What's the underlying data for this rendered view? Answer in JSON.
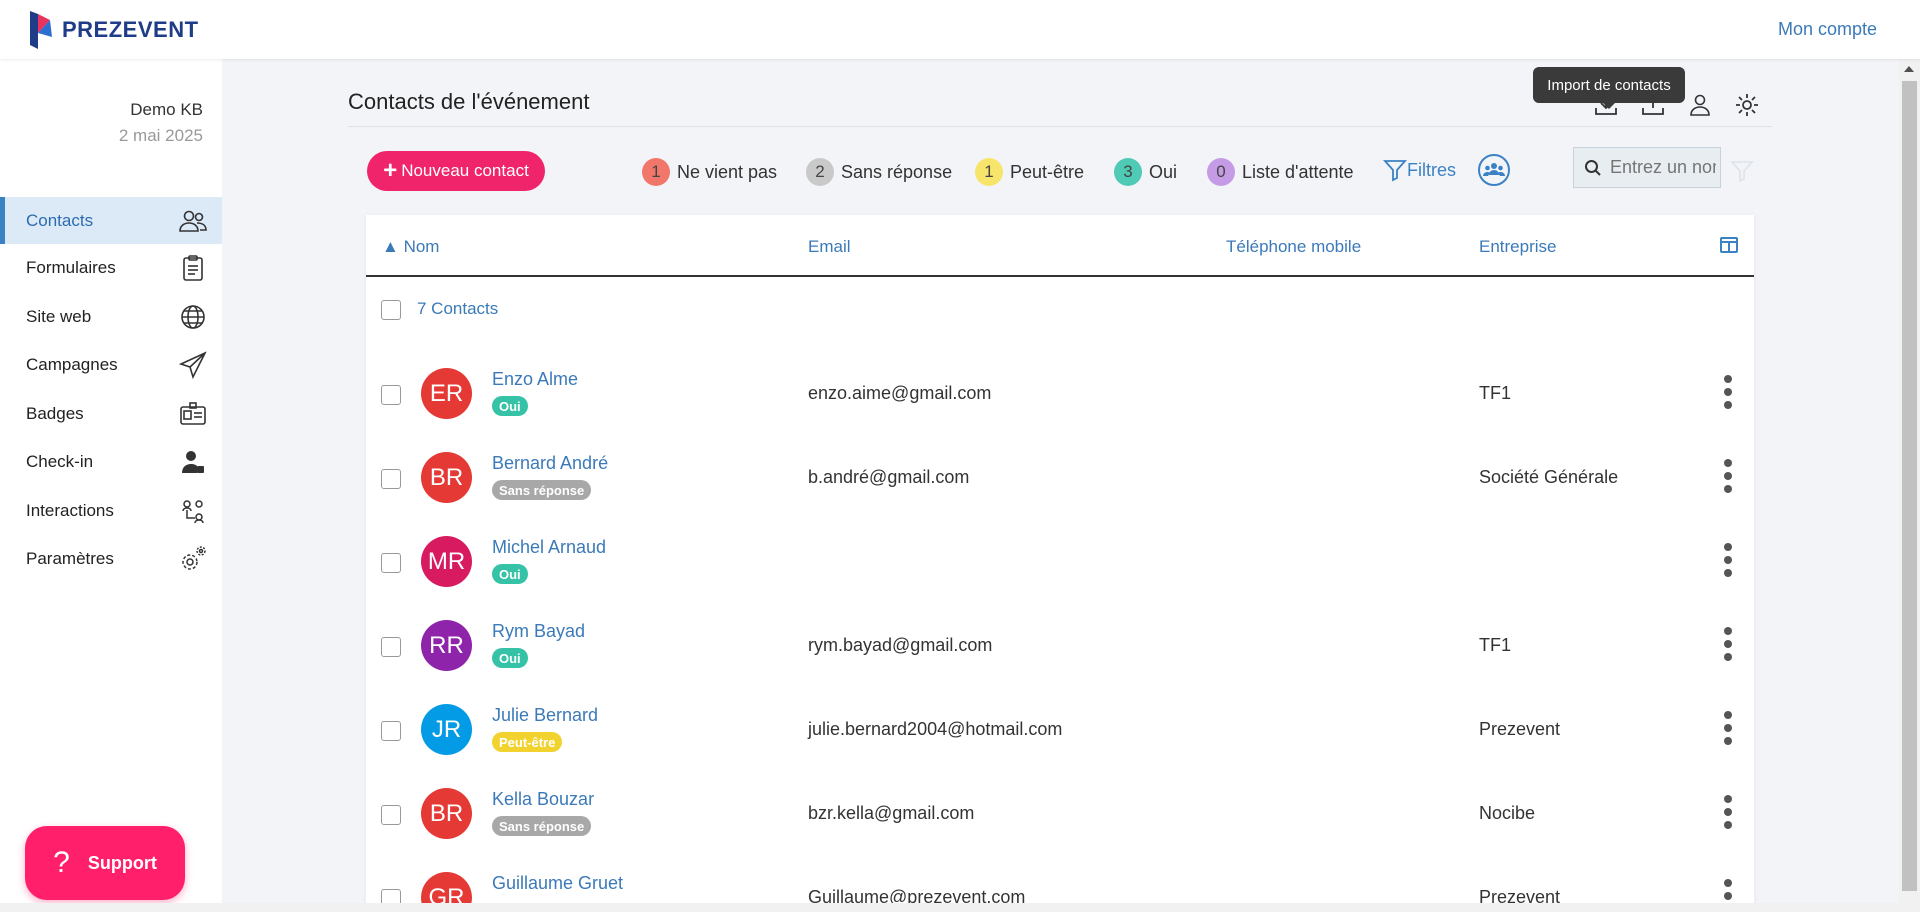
{
  "brand": {
    "name": "PREZEVENT"
  },
  "topbar": {
    "account_link": "Mon compte"
  },
  "sidebar": {
    "event_name": "Demo KB",
    "event_date": "2 mai 2025",
    "items": [
      {
        "label": "Contacts",
        "icon": "contacts-icon",
        "active": true
      },
      {
        "label": "Formulaires",
        "icon": "clipboard-icon"
      },
      {
        "label": "Site web",
        "icon": "globe-icon"
      },
      {
        "label": "Campagnes",
        "icon": "paper-plane-icon"
      },
      {
        "label": "Badges",
        "icon": "badge-card-icon"
      },
      {
        "label": "Check-in",
        "icon": "user-check-icon"
      },
      {
        "label": "Interactions",
        "icon": "interactions-icon"
      },
      {
        "label": "Paramètres",
        "icon": "gears-icon"
      }
    ],
    "support_label": "Support"
  },
  "header": {
    "title": "Contacts de l'événement",
    "tooltip": "Import de contacts"
  },
  "toolbar": {
    "new_contact_label": "Nouveau contact",
    "status_filters": [
      {
        "count": "1",
        "label": "Ne vient pas",
        "color": "#f2776b"
      },
      {
        "count": "2",
        "label": "Sans réponse",
        "color": "#c9c9c9"
      },
      {
        "count": "1",
        "label": "Peut-être",
        "color": "#f7e46a"
      },
      {
        "count": "3",
        "label": "Oui",
        "color": "#4fcab5"
      },
      {
        "count": "0",
        "label": "Liste d'attente",
        "color": "#c59be6"
      }
    ],
    "filters_label": "Filtres",
    "search_placeholder": "Entrez un nom"
  },
  "table": {
    "columns": {
      "name": "Nom",
      "email": "Email",
      "phone": "Téléphone mobile",
      "company": "Entreprise"
    },
    "count_label": "7 Contacts",
    "rows": [
      {
        "initials": "ER",
        "name": "Enzo Alme",
        "status": "Oui",
        "email": "enzo.aime@gmail.com",
        "phone": "",
        "company": "TF1",
        "avatar_color": "#e53935",
        "status_color": "#35c2a6"
      },
      {
        "initials": "BR",
        "name": "Bernard André",
        "status": "Sans réponse",
        "email": "b.andré@gmail.com",
        "phone": "",
        "company": "Société Générale",
        "avatar_color": "#e53935",
        "status_color": "#a8a8a8"
      },
      {
        "initials": "MR",
        "name": "Michel Arnaud",
        "status": "Oui",
        "email": "",
        "phone": "",
        "company": "",
        "avatar_color": "#d81b60",
        "status_color": "#35c2a6"
      },
      {
        "initials": "RR",
        "name": "Rym Bayad",
        "status": "Oui",
        "email": "rym.bayad@gmail.com",
        "phone": "",
        "company": "TF1",
        "avatar_color": "#8e24aa",
        "status_color": "#35c2a6"
      },
      {
        "initials": "JR",
        "name": "Julie Bernard",
        "status": "Peut-être",
        "email": "julie.bernard2004@hotmail.com",
        "phone": "",
        "company": "Prezevent",
        "avatar_color": "#039be5",
        "status_color": "#f2d22e"
      },
      {
        "initials": "BR",
        "name": "Kella Bouzar",
        "status": "Sans réponse",
        "email": "bzr.kella@gmail.com",
        "phone": "",
        "company": "Nocibe",
        "avatar_color": "#e53935",
        "status_color": "#a8a8a8"
      },
      {
        "initials": "GR",
        "name": "Guillaume Gruet",
        "status": "",
        "email": "Guillaume@prezevent.com",
        "phone": "",
        "company": "Prezevent",
        "avatar_color": "#e53935",
        "status_color": "#a8a8a8"
      }
    ]
  }
}
